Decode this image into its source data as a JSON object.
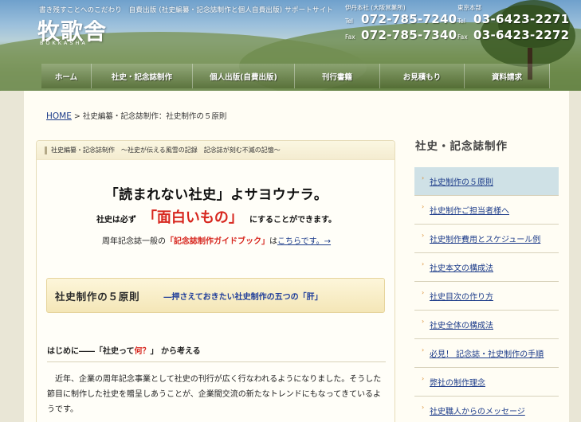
{
  "header": {
    "tagline": "書き残すことへのこだわり　自費出版 (社史編纂・記念誌制作と個人自費出版) サポートサイト",
    "logo": "牧歌舎",
    "logo_sub": "BOKKASHA",
    "offices": [
      {
        "name": "伊丹本社 (大阪営業所)",
        "tel_label": "Tel",
        "tel": "072-785-7240",
        "fax_label": "Fax",
        "fax": "072-785-7340"
      },
      {
        "name": "東京本部",
        "tel_label": "Tel",
        "tel": "03-6423-2271",
        "fax_label": "Fax",
        "fax": "03-6423-2272"
      }
    ]
  },
  "nav": [
    "ホーム",
    "社史・記念誌制作",
    "個人出版(自費出版)",
    "刊行書籍",
    "お見積もり",
    "資料請求"
  ],
  "breadcrumb": {
    "home": "HOME",
    "rest": "> 社史編纂・記念誌制作：社史制作の５原則"
  },
  "main": {
    "head": "社史編纂・記念誌制作　〜社史が伝える風雪の記録　記念誌が刻む不滅の記憶〜",
    "hero1": "「読まれない社史」よサヨウナラ。",
    "hero2_pre": "社史は必ず",
    "hero2_red": "「面白いもの」",
    "hero2_post": "にすることができます。",
    "hero3_pre": "周年記念誌一般の",
    "hero3_red": "「記念誌制作ガイドブック」",
    "hero3_mid": "は",
    "hero3_link": "こちらです。→",
    "section_title": "社史制作の５原則",
    "section_sub": "―押さえておきたい社史制作の五つの「肝」",
    "intro_pre": "はじめに――「社史って",
    "intro_red": "何？",
    "intro_post": "」 から考える",
    "body": "近年、企業の周年記念事業として社史の刊行が広く行なわれるようになりました。そうした節目に制作した社史を贈呈しあうことが、企業間交流の新たなトレンドにもなってきているようです。"
  },
  "sidebar": {
    "title": "社史・記念誌制作",
    "items": [
      "社史制作の５原則",
      "社史制作ご担当者様へ",
      "社史制作費用とスケジュール例",
      "社史本文の構成法",
      "社史目次の作り方",
      "社史全体の構成法",
      "必見！ 記念誌・社史制作の手順",
      "弊社の制作理念",
      "社史職人からのメッセージ"
    ]
  }
}
